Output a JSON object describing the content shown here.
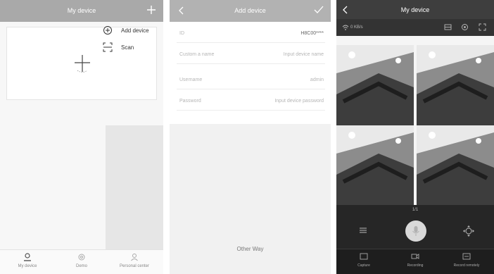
{
  "screen1": {
    "title": "My device",
    "menu": [
      {
        "label": "Add device",
        "icon": "plus-circle-icon"
      },
      {
        "label": "Scan",
        "icon": "scan-icon"
      }
    ],
    "tabs": [
      {
        "label": "My device",
        "icon": "person-icon"
      },
      {
        "label": "Demo",
        "icon": "gear-icon"
      },
      {
        "label": "Personal center",
        "icon": "user-icon"
      }
    ]
  },
  "screen2": {
    "title": "Add device",
    "fields": [
      {
        "label": "ID",
        "value": "H8C00****"
      },
      {
        "label": "Custom a name",
        "value": "Input device name"
      },
      {
        "label": "Username",
        "value": "admin"
      },
      {
        "label": "Password",
        "value": "Input device password"
      }
    ],
    "other_way": "Other Way"
  },
  "screen3": {
    "title": "My device",
    "rate": "0 KB/s",
    "page": "1/1",
    "tabs": [
      {
        "label": "Capture",
        "icon": "capture-icon"
      },
      {
        "label": "Recording",
        "icon": "recording-icon"
      },
      {
        "label": "Record remotely",
        "icon": "record-remote-icon"
      }
    ]
  },
  "colors": {
    "header_gray": "#a9a9a9",
    "dark_bg": "#262626"
  }
}
